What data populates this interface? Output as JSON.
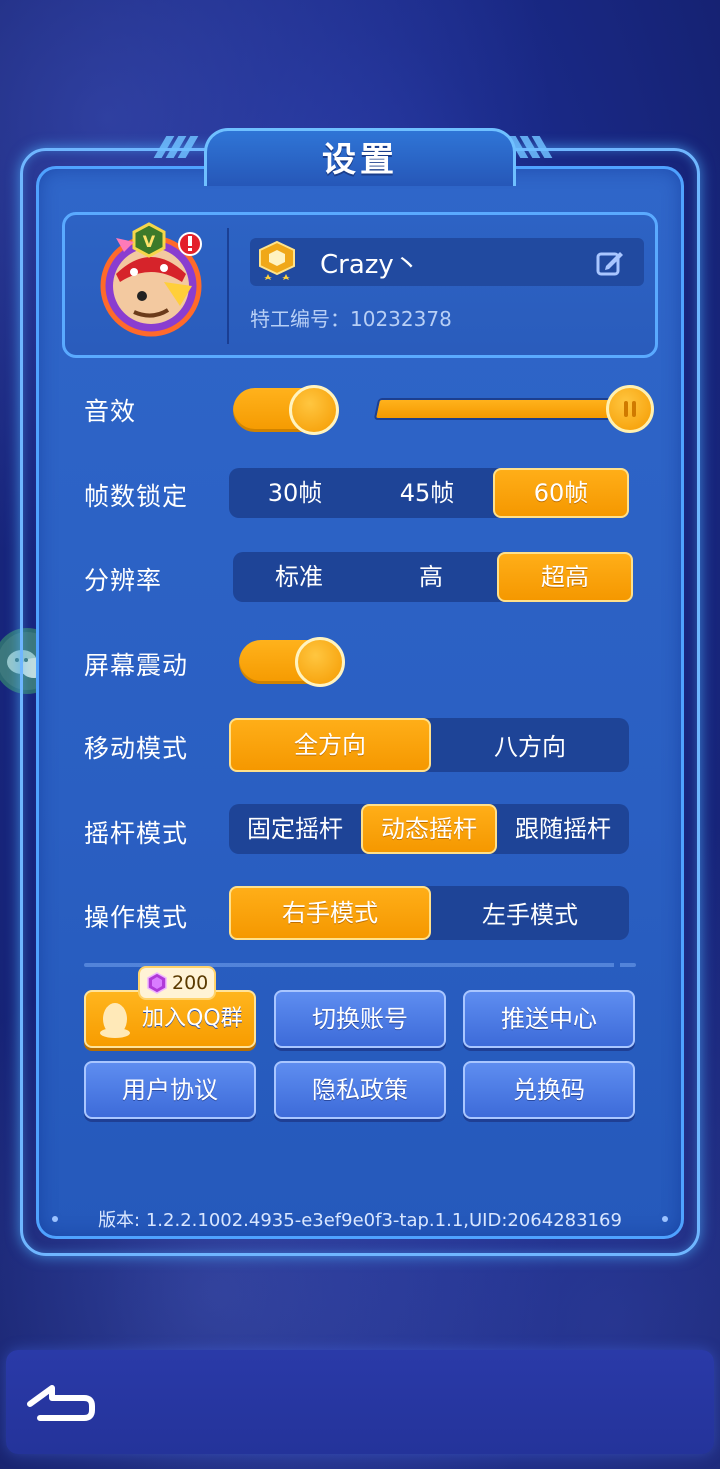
{
  "title": "设置",
  "profile": {
    "name": "Crazy丶",
    "agent_id_label": "特工编号：10232378",
    "avatar_level_badge": "V"
  },
  "settings": {
    "sound": {
      "label": "音效",
      "enabled": true,
      "volume_fraction": 1.0
    },
    "fps": {
      "label": "帧数锁定",
      "options": [
        "30帧",
        "45帧",
        "60帧"
      ],
      "selected": "60帧"
    },
    "resolution": {
      "label": "分辨率",
      "options": [
        "标准",
        "高",
        "超高"
      ],
      "selected": "超高"
    },
    "vibration": {
      "label": "屏幕震动",
      "enabled": true
    },
    "move_mode": {
      "label": "移动模式",
      "options": [
        "全方向",
        "八方向"
      ],
      "selected": "全方向"
    },
    "joystick_mode": {
      "label": "摇杆模式",
      "options": [
        "固定摇杆",
        "动态摇杆",
        "跟随摇杆"
      ],
      "selected": "动态摇杆"
    },
    "control_mode": {
      "label": "操作模式",
      "options": [
        "右手模式",
        "左手模式"
      ],
      "selected": "右手模式"
    }
  },
  "buttons": {
    "join_qq": "加入QQ群",
    "qq_reward": "200",
    "switch_account": "切换账号",
    "push_center": "推送中心",
    "user_agreement": "用户协议",
    "privacy_policy": "隐私政策",
    "redeem_code": "兑换码"
  },
  "version": "版本: 1.2.2.1002.4935-e3ef9e0f3-tap.1.1,UID:2064283169",
  "colors": {
    "accent_orange": "#f7a000",
    "panel_blue": "#2f66c9",
    "segment_dark": "#1e4497"
  }
}
